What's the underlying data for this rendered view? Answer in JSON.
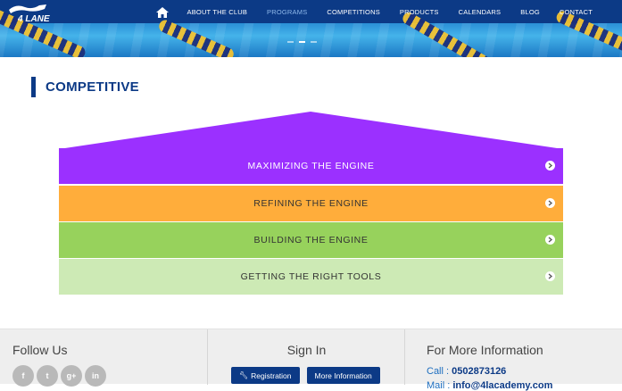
{
  "brand": {
    "logo_text": "4 LANE"
  },
  "nav": {
    "items": [
      {
        "label": "ABOUT THE CLUB",
        "active": false
      },
      {
        "label": "PROGRAMS",
        "active": true
      },
      {
        "label": "COMPETITIONS",
        "active": false
      },
      {
        "label": "PRODUCTS",
        "active": false
      },
      {
        "label": "CALENDARS",
        "active": false
      },
      {
        "label": "BLOG",
        "active": false
      },
      {
        "label": "CONTACT",
        "active": false
      }
    ]
  },
  "page": {
    "title": "COMPETITIVE"
  },
  "pyramid": {
    "levels": [
      {
        "label": "MAXIMIZING THE ENGINE",
        "color": "#9b30ff"
      },
      {
        "label": "REFINING THE ENGINE",
        "color": "#ffad3b"
      },
      {
        "label": "BUILDING THE ENGINE",
        "color": "#97d25c"
      },
      {
        "label": "GETTING THE RIGHT TOOLS",
        "color": "#cdeab5"
      }
    ]
  },
  "footer": {
    "follow": {
      "heading": "Follow Us",
      "socials": [
        {
          "icon": "facebook-icon",
          "glyph": "f"
        },
        {
          "icon": "twitter-icon",
          "glyph": "t"
        },
        {
          "icon": "google-plus-icon",
          "glyph": "g+"
        },
        {
          "icon": "linkedin-icon",
          "glyph": "in"
        }
      ]
    },
    "signin": {
      "heading": "Sign In",
      "registration_label": "Registration",
      "more_info_label": "More Information"
    },
    "info": {
      "heading": "For More Information",
      "call_label": "Call : ",
      "phone": "0502873126",
      "mail_label": "Mail : ",
      "email": "info@4lacademy.com"
    }
  },
  "colors": {
    "brand_blue": "#0c3a86",
    "purple": "#9b30ff",
    "orange": "#ffad3b",
    "green": "#97d25c",
    "light_green": "#cdeab5"
  }
}
